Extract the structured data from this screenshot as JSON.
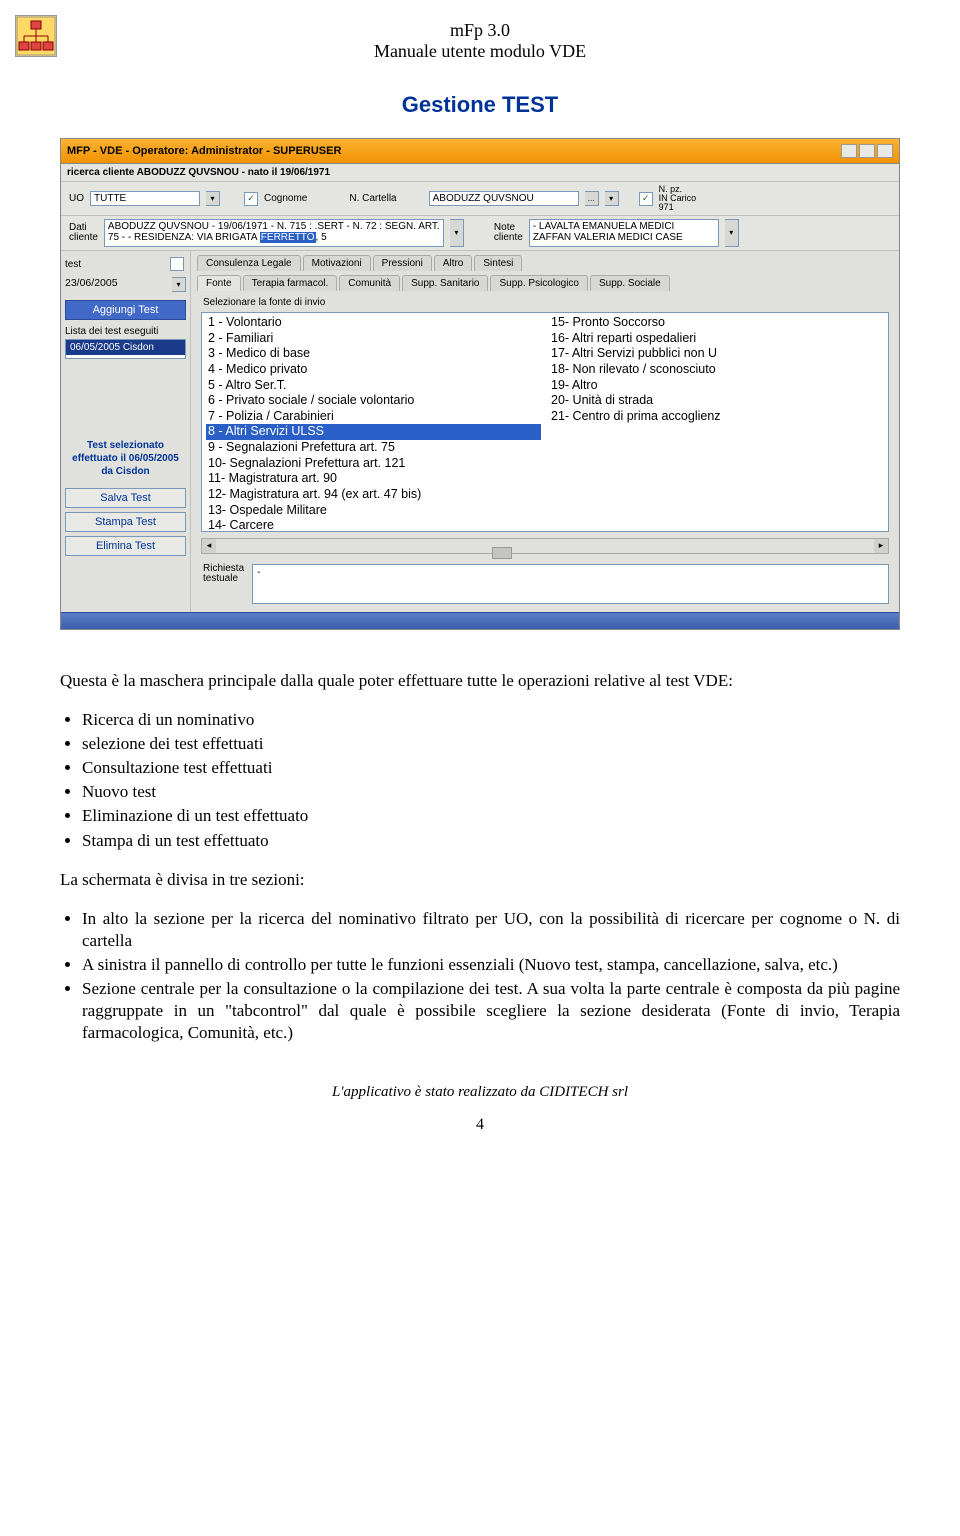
{
  "header": {
    "title": "mFp 3.0",
    "subtitle": "Manuale utente modulo VDE",
    "section": "Gestione TEST"
  },
  "app": {
    "titlebar": "MFP - VDE  - Operatore: Administrator -  SUPERUSER",
    "search_strip": "ricerca cliente ABODUZZ QUVSNOU - nato il 19/06/1971",
    "row1": {
      "uo_label": "UO",
      "uo_value": "TUTTE",
      "cognome_chk": true,
      "cognome_label": "Cognome",
      "ncart_label": "N. Cartella",
      "client_name": "ABODUZZ QUVSNOU",
      "npz_chk": true,
      "npz_label1": "N. pz.",
      "npz_label2": "IN Carico",
      "npz_value": "971"
    },
    "row2": {
      "dati_label": "Dati\ncliente",
      "dati_value": "ABODUZZ QUVSNOU - 19/06/1971 - N. 715 : .SERT - N. 72 : SEGN. ART. 75 -  - RESIDENZA: VIA BRIGATA FERRETTO, 5",
      "dati_hl": "FERRETTO",
      "note_label": "Note\ncliente",
      "note_value": "- LAVALTA EMANUELA MEDICI\nZAFFAN VALERIA MEDICI CASE"
    },
    "sidebar": {
      "test_tab": "test",
      "date": "23/06/2005",
      "add_btn": "Aggiungi Test",
      "list_label": "Lista dei test eseguiti",
      "list_item": "06/05/2005   Cisdon",
      "selected_info": "Test selezionato effettuato il 06/05/2005 da Cisdon",
      "save_btn": "Salva Test",
      "print_btn": "Stampa Test",
      "delete_btn": "Elimina Test"
    },
    "tabs_top": [
      "Consulenza Legale",
      "Motivazioni",
      "Pressioni",
      "Altro",
      "Sintesi"
    ],
    "tabs_bot": [
      "Fonte",
      "Terapia farmacol.",
      "Comunità",
      "Supp. Sanitario",
      "Supp. Psicologico",
      "Supp. Sociale"
    ],
    "fonte_label": "Selezionare la fonte di invio",
    "fonte_left": [
      "1   - Volontario",
      "2   - Familiari",
      "3   - Medico di base",
      "4   - Medico privato",
      "5   - Altro Ser.T.",
      "6   - Privato sociale / sociale volontario",
      "7   - Polizia / Carabinieri",
      "8   - Altri Servizi ULSS",
      "9   - Segnalazioni Prefettura art. 75",
      "10- Segnalazioni Prefettura art. 121",
      "11- Magistratura art. 90",
      "12- Magistratura art. 94 (ex art. 47 bis)",
      "13- Ospedale Militare",
      "14- Carcere"
    ],
    "fonte_left_selected": 7,
    "fonte_right": [
      "15- Pronto Soccorso",
      "16- Altri reparti ospedalieri",
      "17- Altri Servizi pubblici non U",
      "18- Non rilevato / sconosciuto",
      "19- Altro",
      "20- Unità di strada",
      "21- Centro di prima accoglienz"
    ],
    "richiesta_label": "Richiesta\ntestuale",
    "richiesta_value": "-"
  },
  "body": {
    "intro": "Questa è la maschera principale dalla quale poter effettuare tutte le operazioni relative al test VDE:",
    "list1": [
      "Ricerca di un nominativo",
      "selezione dei test effettuati",
      "Consultazione test effettuati",
      "Nuovo test",
      "Eliminazione di un test effettuato",
      "Stampa di un test effettuato"
    ],
    "para2": "La schermata è divisa in tre sezioni:",
    "list2": [
      "In alto la sezione per la ricerca del nominativo filtrato per UO, con la possibilità di ricercare per cognome o N. di cartella",
      "A sinistra il pannello di controllo per tutte le funzioni essenziali (Nuovo test, stampa, cancellazione, salva, etc.)",
      "Sezione centrale per la consultazione o la compilazione dei test. A sua volta la parte centrale è composta da più pagine raggruppate in un \"tabcontrol\" dal quale è possibile scegliere la sezione desiderata (Fonte di invio, Terapia farmacologica, Comunità, etc.)"
    ]
  },
  "footer": {
    "note": "L'applicativo è stato realizzato da CIDITECH srl",
    "page": "4"
  }
}
